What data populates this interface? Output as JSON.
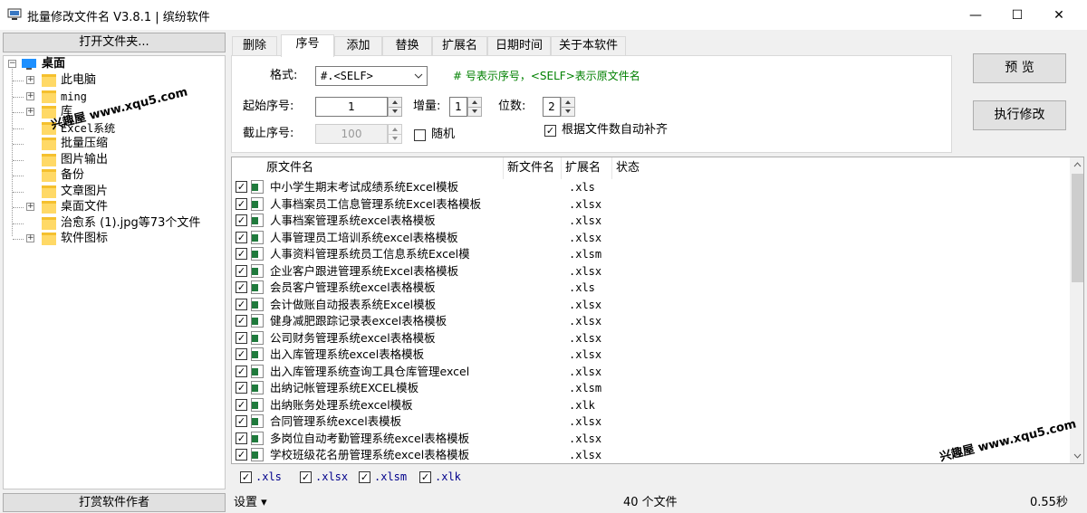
{
  "window": {
    "title": "批量修改文件名 V3.8.1 | 缤纷软件",
    "minimize": "—",
    "maximize": "☐",
    "close": "✕"
  },
  "left": {
    "open_folder_label": "打开文件夹...",
    "tip_author_label": "打赏软件作者",
    "tree": {
      "root": "桌面",
      "items": [
        {
          "label": "此电脑",
          "expandable": true
        },
        {
          "label": "ming",
          "expandable": true
        },
        {
          "label": "库",
          "expandable": true
        },
        {
          "label": "Excel系统",
          "expandable": false
        },
        {
          "label": "批量压缩",
          "expandable": false
        },
        {
          "label": "图片输出",
          "expandable": false
        },
        {
          "label": "备份",
          "expandable": false
        },
        {
          "label": "文章图片",
          "expandable": false
        },
        {
          "label": "桌面文件",
          "expandable": true
        },
        {
          "label": "治愈系 (1).jpg等73个文件",
          "expandable": false
        },
        {
          "label": "软件图标",
          "expandable": true
        }
      ]
    },
    "watermark": "兴趣屋 www.xqu5.com"
  },
  "tabs": [
    "删除",
    "序号",
    "添加",
    "替换",
    "扩展名",
    "日期时间",
    "关于本软件"
  ],
  "active_tab": "序号",
  "serial": {
    "format_label": "格式:",
    "format_value": "#.<SELF>",
    "format_hint": "# 号表示序号，<SELF>表示原文件名",
    "start_label": "起始序号:",
    "start_value": "1",
    "increment_label": "增量:",
    "increment_value": "1",
    "digits_label": "位数:",
    "digits_value": "2",
    "end_label": "截止序号:",
    "end_value": "100",
    "random_label": "随机",
    "random_checked": false,
    "autopad_label": "根据文件数自动补齐",
    "autopad_checked": true
  },
  "buttons": {
    "preview": "预 览",
    "execute": "执行修改"
  },
  "grid": {
    "columns": [
      "原文件名",
      "新文件名",
      "扩展名",
      "状态"
    ],
    "rows": [
      {
        "name": "中小学生期末考试成绩系统Excel模板",
        "ext": ".xls"
      },
      {
        "name": "人事档案员工信息管理系统Excel表格模板",
        "ext": ".xlsx"
      },
      {
        "name": "人事档案管理系统excel表格模板",
        "ext": ".xlsx"
      },
      {
        "name": "人事管理员工培训系统excel表格模板",
        "ext": ".xlsx"
      },
      {
        "name": "人事资料管理系统员工信息系统Excel模",
        "ext": ".xlsm"
      },
      {
        "name": "企业客户跟进管理系统Excel表格模板",
        "ext": ".xlsx"
      },
      {
        "name": "会员客户管理系统excel表格模板",
        "ext": ".xls"
      },
      {
        "name": "会计做账自动报表系统Excel模板",
        "ext": ".xlsx"
      },
      {
        "name": "健身减肥跟踪记录表excel表格模板",
        "ext": ".xlsx"
      },
      {
        "name": "公司财务管理系统excel表格模板",
        "ext": ".xlsx"
      },
      {
        "name": "出入库管理系统excel表格模板",
        "ext": ".xlsx"
      },
      {
        "name": "出入库管理系统查询工具仓库管理excel",
        "ext": ".xlsx"
      },
      {
        "name": "出纳记帐管理系统EXCEL模板",
        "ext": ".xlsm"
      },
      {
        "name": "出纳账务处理系统excel模板",
        "ext": ".xlk"
      },
      {
        "name": "合同管理系统excel表模板",
        "ext": ".xlsx"
      },
      {
        "name": "多岗位自动考勤管理系统excel表格模板",
        "ext": ".xlsx"
      },
      {
        "name": "学校班级花名册管理系统excel表格模板",
        "ext": ".xlsx"
      }
    ]
  },
  "filters": [
    ".xls",
    ".xlsx",
    ".xlsm",
    ".xlk"
  ],
  "status": {
    "settings": "设置 ▾",
    "count": "40 个文件",
    "time": "0.55秒"
  },
  "watermark_right": "兴趣屋 www.xqu5.com"
}
